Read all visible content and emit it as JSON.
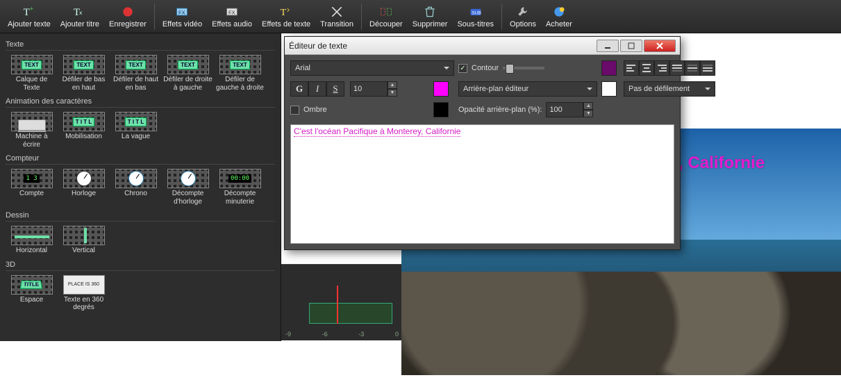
{
  "toolbar": {
    "add_text": "Ajouter texte",
    "add_title": "Ajouter titre",
    "record": "Enregistrer",
    "video_fx": "Effets vidéo",
    "audio_fx": "Effets audio",
    "text_fx": "Effets de texte",
    "transition": "Transition",
    "split": "Découper",
    "delete": "Supprimer",
    "subtitles": "Sous-titres",
    "options": "Options",
    "buy": "Acheter"
  },
  "sections": {
    "text": "Texte",
    "char_anim": "Animation des caractères",
    "counter": "Compteur",
    "drawing": "Dessin",
    "three_d": "3D"
  },
  "presets": {
    "text": [
      {
        "label": "Calque de Texte",
        "tag": "TEXT"
      },
      {
        "label": "Défiler de bas en haut",
        "tag": "TEXT"
      },
      {
        "label": "Défiler de haut en bas",
        "tag": "TEXT"
      },
      {
        "label": "Défiler de droite à gauche",
        "tag": "TEXT"
      },
      {
        "label": "Défiler de gauche à droite",
        "tag": "TEXT"
      }
    ],
    "char_anim": [
      {
        "label": "Machine à écrire",
        "tag": ""
      },
      {
        "label": "Mobilisation",
        "tag": "T I T L"
      },
      {
        "label": "La vague",
        "tag": "T I T L"
      }
    ],
    "counter": [
      {
        "label": "Compte"
      },
      {
        "label": "Horloge"
      },
      {
        "label": "Chrono"
      },
      {
        "label": "Décompte d'horloge"
      },
      {
        "label": "Décompte minuterie"
      }
    ],
    "drawing": [
      {
        "label": "Horizontal"
      },
      {
        "label": "Vertical"
      }
    ],
    "three_d": [
      {
        "label": "Espace",
        "tag": "TITLE"
      },
      {
        "label": "Texte en 360 degrés",
        "tag": "PLACE IS 360"
      }
    ]
  },
  "dialog": {
    "title": "Éditeur de texte",
    "font": "Arial",
    "outline_label": "Contour",
    "outline_checked": true,
    "outline_color": "#6a0a6a",
    "bold": "G",
    "italic": "I",
    "underline": "S",
    "size": "10",
    "text_color": "#ff00ff",
    "bg_mode": "Arrière-plan éditeur",
    "bg_color": "#ffffff",
    "scroll_mode": "Pas de défilement",
    "shadow_label": "Ombre",
    "shadow_checked": false,
    "shadow_color": "#000000",
    "bg_opacity_label": "Opacité arrière-plan (%):",
    "bg_opacity": "100",
    "entered_text": "C'est l'océan Pacifique à Monterey, Californie"
  },
  "preview_text": "C'est l'océan Pacifique à Monterey, Californie",
  "timeline_ticks": [
    "-9",
    "-6",
    "-3",
    "0"
  ]
}
